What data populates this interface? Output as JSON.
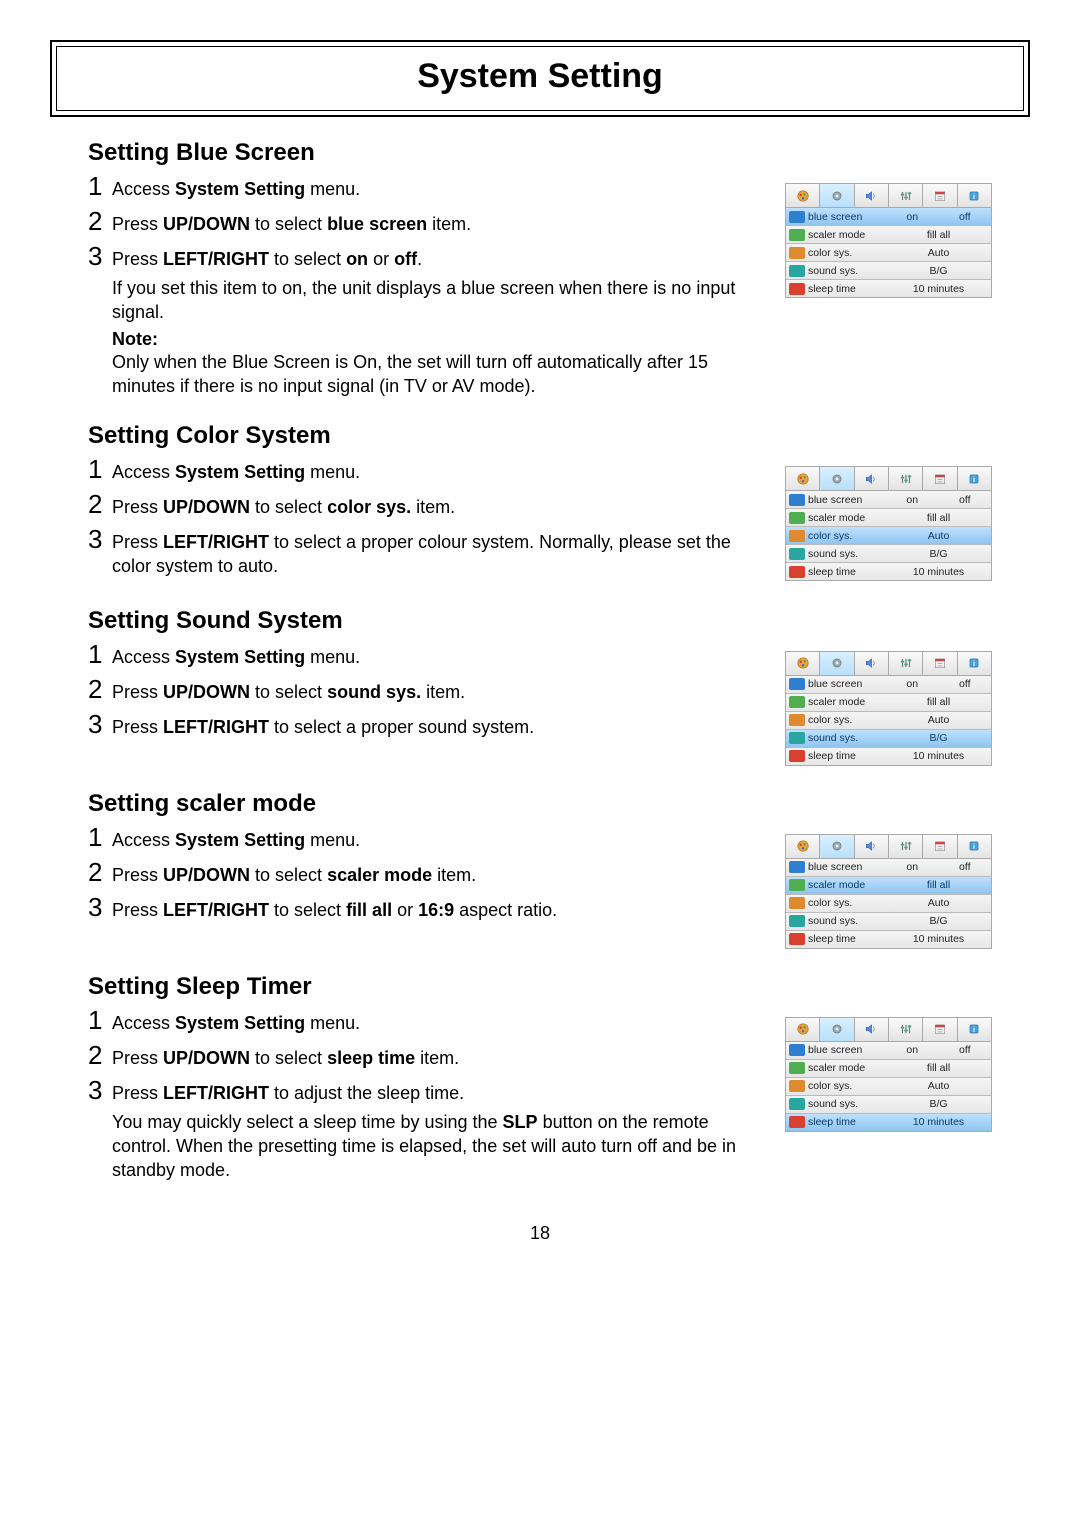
{
  "page_title": "System Setting",
  "page_number": "18",
  "osd_labels": {
    "blue_screen": "blue screen",
    "scaler_mode": "scaler mode",
    "color_sys": "color sys.",
    "sound_sys": "sound sys.",
    "sleep_time": "sleep time"
  },
  "osd_values": {
    "on": "on",
    "off": "off",
    "fill_all": "fill all",
    "auto": "Auto",
    "bg": "B/G",
    "ten_minutes": "10 minutes"
  },
  "sections": [
    {
      "heading": "Setting Blue Screen",
      "steps": [
        {
          "n": "1",
          "parts": [
            {
              "t": "Access "
            },
            {
              "t": "System Setting",
              "b": true
            },
            {
              "t": " menu."
            }
          ]
        },
        {
          "n": "2",
          "parts": [
            {
              "t": "Press "
            },
            {
              "t": "UP/DOWN",
              "b": true
            },
            {
              "t": " to select "
            },
            {
              "t": "blue screen",
              "b": true
            },
            {
              "t": " item."
            }
          ]
        },
        {
          "n": "3",
          "parts": [
            {
              "t": "Press "
            },
            {
              "t": "LEFT/RIGHT",
              "b": true
            },
            {
              "t": " to select "
            },
            {
              "t": "on",
              "b": true
            },
            {
              "t": " or "
            },
            {
              "t": "off",
              "b": true
            },
            {
              "t": "."
            }
          ],
          "body": "If you set this item to on, the unit displays a blue screen when there is no input signal."
        }
      ],
      "note_label": "Note:",
      "note_text": "Only when the Blue Screen is On, the set will turn off automatically after 15 minutes if there is no input signal (in TV or AV mode).",
      "selected_row": 0,
      "blue_split": false
    },
    {
      "heading": "Setting Color System",
      "steps": [
        {
          "n": "1",
          "parts": [
            {
              "t": "Access "
            },
            {
              "t": "System Setting",
              "b": true
            },
            {
              "t": " menu."
            }
          ]
        },
        {
          "n": "2",
          "parts": [
            {
              "t": "Press "
            },
            {
              "t": "UP/DOWN",
              "b": true
            },
            {
              "t": " to select "
            },
            {
              "t": "color sys.",
              "b": true
            },
            {
              "t": " item."
            }
          ]
        },
        {
          "n": "3",
          "parts": [
            {
              "t": "Press "
            },
            {
              "t": "LEFT/RIGHT",
              "b": true
            },
            {
              "t": " to select a proper colour system. Normally, please set the color system to auto."
            }
          ]
        }
      ],
      "selected_row": 2,
      "blue_split": true
    },
    {
      "heading": "Setting Sound System",
      "steps": [
        {
          "n": "1",
          "parts": [
            {
              "t": "Access "
            },
            {
              "t": "System Setting",
              "b": true
            },
            {
              "t": " menu."
            }
          ]
        },
        {
          "n": "2",
          "parts": [
            {
              "t": "Press "
            },
            {
              "t": "UP/DOWN",
              "b": true
            },
            {
              "t": " to select "
            },
            {
              "t": "sound sys.",
              "b": true
            },
            {
              "t": " item."
            }
          ]
        },
        {
          "n": "3",
          "parts": [
            {
              "t": "Press "
            },
            {
              "t": "LEFT/RIGHT",
              "b": true
            },
            {
              "t": " to select a proper sound system."
            }
          ]
        }
      ],
      "selected_row": 3,
      "blue_split": true
    },
    {
      "heading": "Setting scaler mode",
      "steps": [
        {
          "n": "1",
          "parts": [
            {
              "t": "Access "
            },
            {
              "t": "System Setting",
              "b": true
            },
            {
              "t": " menu."
            }
          ]
        },
        {
          "n": "2",
          "parts": [
            {
              "t": "Press "
            },
            {
              "t": "UP/DOWN",
              "b": true
            },
            {
              "t": " to select "
            },
            {
              "t": "scaler mode",
              "b": true
            },
            {
              "t": " item."
            }
          ]
        },
        {
          "n": "3",
          "parts": [
            {
              "t": "Press "
            },
            {
              "t": "LEFT/RIGHT",
              "b": true
            },
            {
              "t": " to select "
            },
            {
              "t": "fill all",
              "b": true
            },
            {
              "t": " or "
            },
            {
              "t": "16:9",
              "b": true
            },
            {
              "t": " aspect ratio."
            }
          ]
        }
      ],
      "selected_row": 1,
      "blue_split": true
    },
    {
      "heading": "Setting Sleep Timer",
      "steps": [
        {
          "n": "1",
          "parts": [
            {
              "t": "Access "
            },
            {
              "t": "System Setting",
              "b": true
            },
            {
              "t": " menu."
            }
          ]
        },
        {
          "n": "2",
          "parts": [
            {
              "t": "Press "
            },
            {
              "t": "UP/DOWN",
              "b": true
            },
            {
              "t": " to select "
            },
            {
              "t": "sleep time",
              "b": true
            },
            {
              "t": " item."
            }
          ]
        },
        {
          "n": "3",
          "parts": [
            {
              "t": "Press "
            },
            {
              "t": "LEFT/RIGHT",
              "b": true
            },
            {
              "t": " to adjust the sleep time."
            }
          ],
          "body_rich": [
            {
              "t": "You may quickly select a sleep time by using the "
            },
            {
              "t": "SLP",
              "b": true
            },
            {
              "t": " button on the remote control. When the presetting time is elapsed, the set will auto turn off and be in standby mode."
            }
          ]
        }
      ],
      "selected_row": 4,
      "blue_split": true
    }
  ]
}
